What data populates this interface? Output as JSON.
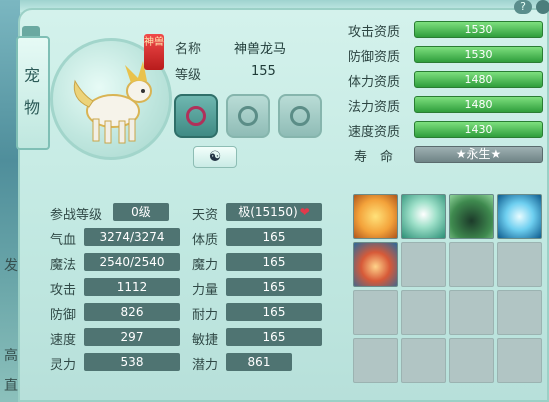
{
  "side": {
    "tab_chars": [
      "宠",
      "物"
    ],
    "left_chars": [
      "发",
      "高",
      "直"
    ]
  },
  "help": "?",
  "pet": {
    "badge": "神兽",
    "name_label": "名称",
    "name": "神兽龙马",
    "level_label": "等级",
    "level": "155",
    "skins": [
      "skin-1",
      "skin-2",
      "skin-3"
    ],
    "yinyang": "☯"
  },
  "qualities": [
    {
      "label": "攻击资质",
      "value": "1530"
    },
    {
      "label": "防御资质",
      "value": "1530"
    },
    {
      "label": "体力资质",
      "value": "1480"
    },
    {
      "label": "法力资质",
      "value": "1480"
    },
    {
      "label": "速度资质",
      "value": "1430"
    }
  ],
  "life": {
    "label": "寿　命",
    "value": "★永生★"
  },
  "stats_left": [
    {
      "label": "参战等级",
      "value": "0级"
    },
    {
      "label": "气血",
      "value": "3274/3274"
    },
    {
      "label": "魔法",
      "value": "2540/2540"
    },
    {
      "label": "攻击",
      "value": "1112"
    },
    {
      "label": "防御",
      "value": "826"
    },
    {
      "label": "速度",
      "value": "297"
    },
    {
      "label": "灵力",
      "value": "538"
    }
  ],
  "stats_right": [
    {
      "label": "天资",
      "value": "极(15150)"
    },
    {
      "label": "体质",
      "value": "165"
    },
    {
      "label": "魔力",
      "value": "165"
    },
    {
      "label": "力量",
      "value": "165"
    },
    {
      "label": "耐力",
      "value": "165"
    },
    {
      "label": "敏捷",
      "value": "165"
    },
    {
      "label": "潜力",
      "value": "861"
    }
  ],
  "skills": [
    "golden-wings-skill",
    "white-wings-skill",
    "cat-spirit-skill",
    "ice-crystal-skill",
    "fire-mountain-skill"
  ]
}
